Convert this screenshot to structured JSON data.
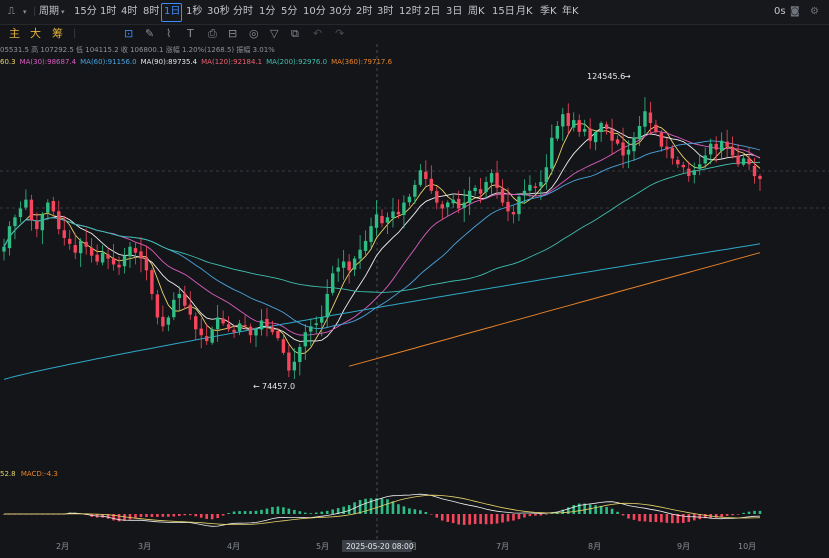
{
  "topbar": {
    "chart_type_icon": "candles-icon",
    "period_label": "周期",
    "intervals": [
      "15分",
      "1时",
      "4时",
      "8时",
      "1日",
      "1秒",
      "30秒",
      "分时",
      "1分",
      "5分",
      "10分",
      "30分",
      "2时",
      "3时",
      "12时",
      "2日",
      "3日",
      "周K",
      "15日",
      "月K",
      "季K",
      "年K"
    ],
    "active_interval": "1日",
    "right_text": "0s"
  },
  "toolbar": {
    "labels": [
      "主",
      "大",
      "筹"
    ]
  },
  "ohlc_line": "05531.5 高 107292.5 低 104115.2 收 106800.1 涨幅 1.20%(1268.5) 振幅 3.01%",
  "ma_line": [
    {
      "text": "60.3",
      "color": "#e8d36a"
    },
    {
      "text": "MA(30):98687.4",
      "color": "#d85dbf"
    },
    {
      "text": "MA(60):91156.0",
      "color": "#4aa3e0"
    },
    {
      "text": "MA(90):89735.4",
      "color": "#e5e5e5"
    },
    {
      "text": "MA(120):92184.1",
      "color": "#e86070"
    },
    {
      "text": "MA(200):92976.0",
      "color": "#3fbfb0"
    },
    {
      "text": "MA(360):79717.6",
      "color": "#e8832a"
    }
  ],
  "macd_info": {
    "prefix": "52.8",
    "label": "MACD:-4.3"
  },
  "annotations": {
    "high": "124545.6",
    "low": "74457.0"
  },
  "crosshair_label": "2025-05-20 08:00",
  "x_labels": [
    "2月",
    "3月",
    "4月",
    "5月",
    "6月",
    "7月",
    "8月",
    "9月",
    "10月"
  ],
  "colors": {
    "up": "#2ebd85",
    "down": "#f6465d",
    "bg": "#141518"
  },
  "chart_data": {
    "type": "line",
    "y_range_price": [
      72000,
      128000
    ],
    "close_series": [
      98000,
      101500,
      103000,
      104500,
      106000,
      102500,
      101000,
      103500,
      105500,
      104000,
      101000,
      99500,
      98500,
      97000,
      99000,
      98000,
      96500,
      95500,
      97000,
      96000,
      95000,
      94500,
      96500,
      98000,
      97000,
      96000,
      94000,
      90000,
      86000,
      84500,
      86000,
      89000,
      90000,
      88000,
      86500,
      84000,
      83000,
      82000,
      84000,
      86000,
      85000,
      84000,
      83500,
      85000,
      84500,
      83000,
      84000,
      85500,
      84500,
      83500,
      82500,
      80000,
      77000,
      78500,
      81000,
      83500,
      84500,
      85000,
      86000,
      90000,
      93500,
      94500,
      95500,
      94000,
      96000,
      97500,
      99000,
      101500,
      103500,
      102000,
      103000,
      104000,
      103500,
      105500,
      106500,
      108500,
      111000,
      109500,
      107500,
      105500,
      104500,
      105500,
      106000,
      104500,
      105500,
      107500,
      108000,
      107000,
      109000,
      110500,
      108000,
      105500,
      104000,
      103500,
      106500,
      107500,
      108500,
      108000,
      109000,
      111500,
      116500,
      118500,
      120500,
      118500,
      119500,
      117500,
      118000,
      116000,
      117500,
      119000,
      118000,
      116000,
      115500,
      113500,
      114500,
      116500,
      118500,
      121000,
      119000,
      117500,
      115000,
      114500,
      113000,
      112000,
      111500,
      110000,
      111000,
      112000,
      113500,
      115500,
      114500,
      116000,
      115000,
      113500,
      112000,
      113000,
      112000,
      110000,
      109500
    ],
    "ma_series": [
      {
        "name": "MA(30)",
        "last": 98687.4
      },
      {
        "name": "MA(60)",
        "last": 91156.0
      },
      {
        "name": "MA(90)",
        "last": 89735.4
      },
      {
        "name": "MA(120)",
        "last": 92184.1
      },
      {
        "name": "MA(200)",
        "last": 92976.0
      },
      {
        "name": "MA(360)",
        "last": 79717.6
      }
    ],
    "xlabel": "",
    "ylabel": "",
    "grid": false
  }
}
